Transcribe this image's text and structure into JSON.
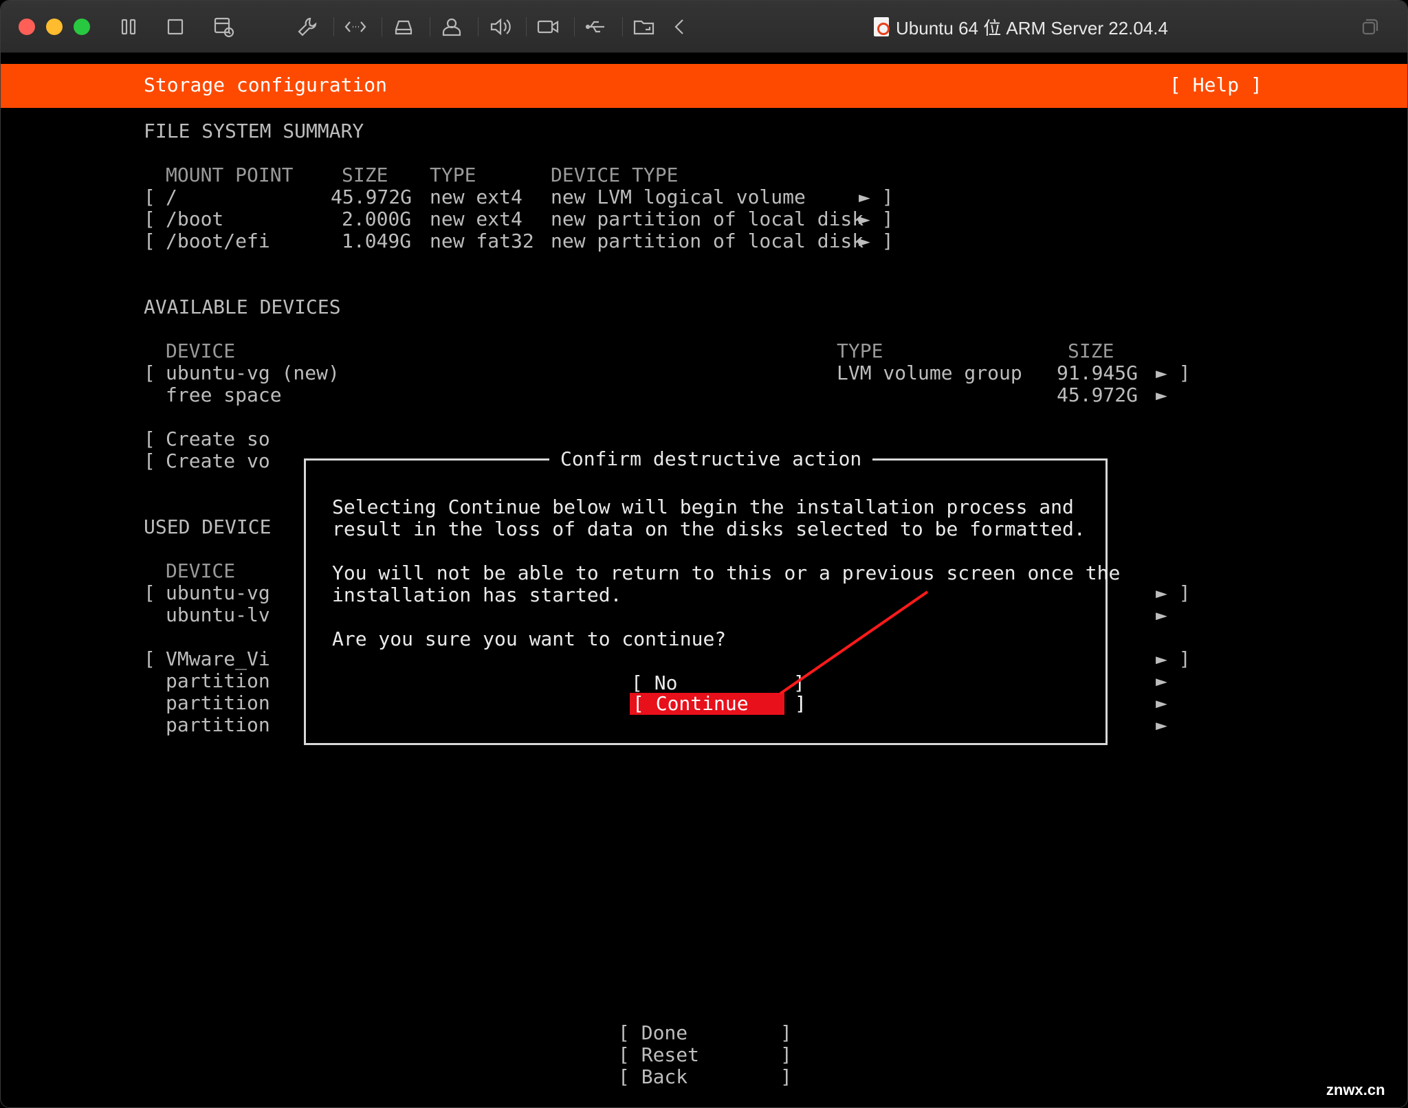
{
  "window": {
    "title": "Ubuntu 64 位 ARM Server 22.04.4"
  },
  "toolbar": {
    "icons": [
      "pause-icon",
      "stop-icon",
      "snapshot-icon",
      "settings-wrench-icon",
      "code-icon",
      "disk-icon",
      "user-icon",
      "sound-icon",
      "camera-icon",
      "usb-icon",
      "folder-share-icon",
      "back-chevron-icon"
    ]
  },
  "header": {
    "title": "Storage configuration",
    "help": "[ Help ]"
  },
  "fs_summary": {
    "heading": "FILE SYSTEM SUMMARY",
    "columns": [
      "MOUNT POINT",
      "SIZE",
      "TYPE",
      "DEVICE TYPE"
    ],
    "rows": [
      {
        "mount": "/",
        "size": "45.972G",
        "type": "new ext4",
        "device_type": "new LVM logical volume"
      },
      {
        "mount": "/boot",
        "size": "2.000G",
        "type": "new ext4",
        "device_type": "new partition of local disk"
      },
      {
        "mount": "/boot/efi",
        "size": "1.049G",
        "type": "new fat32",
        "device_type": "new partition of local disk"
      }
    ]
  },
  "available": {
    "heading": "AVAILABLE DEVICES",
    "columns": [
      "DEVICE",
      "TYPE",
      "SIZE"
    ],
    "device": "ubuntu-vg (new)",
    "type": "LVM volume group",
    "size": "91.945G",
    "free_label": "free space",
    "free_size": "45.972G",
    "create_1": "Create so",
    "create_2": "Create vo"
  },
  "used": {
    "heading": "USED DEVICE",
    "column": "DEVICE",
    "rows": [
      "ubuntu-vg",
      "ubuntu-lv",
      "VMware_Vi",
      "partition",
      "partition",
      "partition"
    ]
  },
  "dialog": {
    "title": "Confirm destructive action",
    "line1": "Selecting Continue below will begin the installation process and",
    "line2": "result in the loss of data on the disks selected to be formatted.",
    "line3": "You will not be able to return to this or a previous screen once the",
    "line4": "installation has started.",
    "line5": "Are you sure you want to continue?",
    "no_label": "No",
    "continue_label": "Continue"
  },
  "footer": {
    "done": "Done",
    "reset": "Reset",
    "back": "Back"
  },
  "watermark": "znwx.cn",
  "colors": {
    "header": "#fd4a00",
    "selected": "#e8101a",
    "annotation": "#ff1a1a"
  }
}
